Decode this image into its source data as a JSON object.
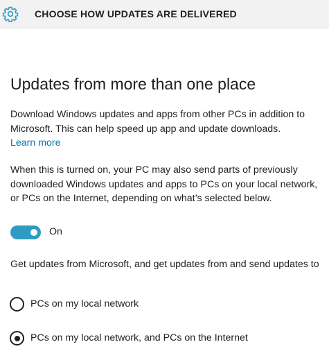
{
  "header": {
    "title": "CHOOSE HOW UPDATES ARE DELIVERED",
    "icon": "gear-icon",
    "accent": "#2d9bc2"
  },
  "main": {
    "heading": "Updates from more than one place",
    "intro": "Download Windows updates and apps from other PCs in addition to Microsoft. This can help speed up app and update downloads.",
    "learn_more": "Learn more",
    "explanation": "When this is turned on, your PC may also send parts of previously downloaded Windows updates and apps to PCs on your local network, or PCs on the Internet, depending on what’s selected below.",
    "toggle": {
      "state_label": "On",
      "on": true,
      "color": "#2d9bc2"
    },
    "options_prompt": "Get updates from Microsoft, and get updates from and send updates to",
    "options": [
      {
        "label": "PCs on my local network",
        "selected": false
      },
      {
        "label": "PCs on my local network, and PCs on the Internet",
        "selected": true
      }
    ]
  }
}
